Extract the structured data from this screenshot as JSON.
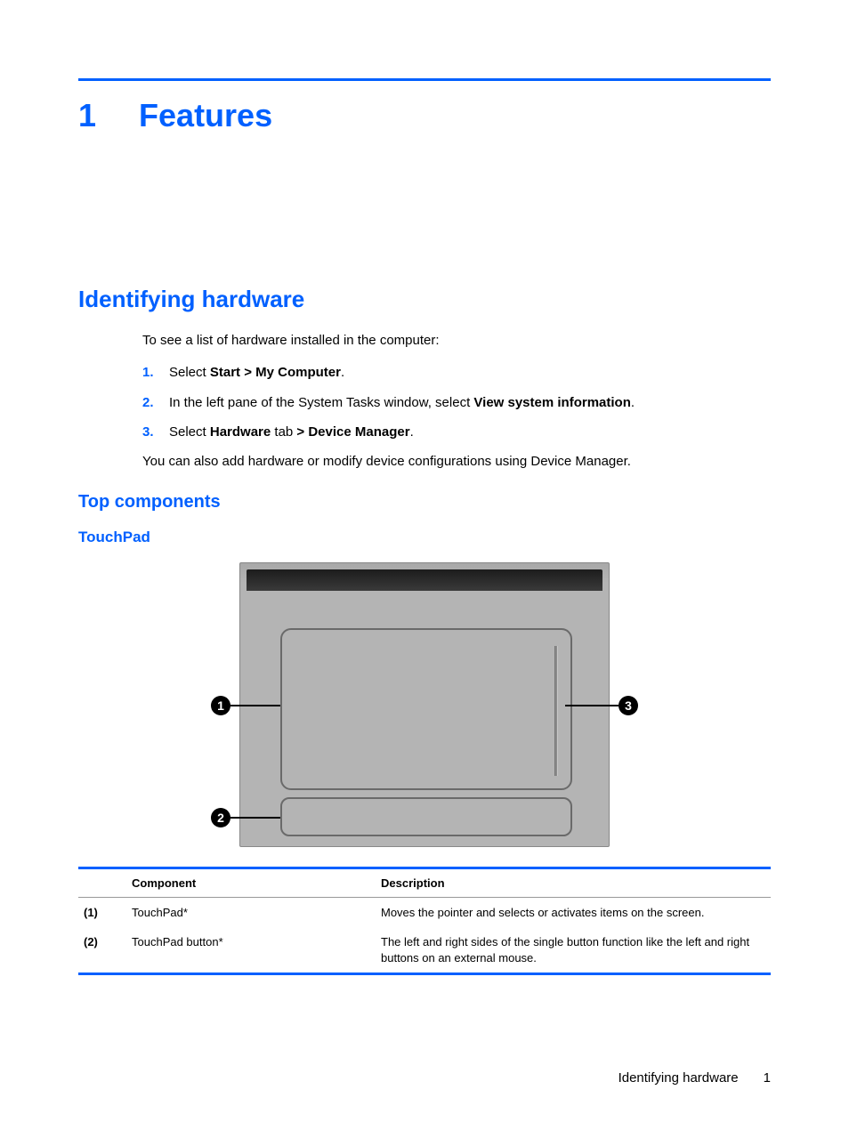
{
  "chapter": {
    "number": "1",
    "title": "Features"
  },
  "section": {
    "title": "Identifying hardware"
  },
  "intro": "To see a list of hardware installed in the computer:",
  "steps": [
    {
      "num": "1.",
      "pre": "Select ",
      "bold": "Start > My Computer",
      "post": "."
    },
    {
      "num": "2.",
      "pre": "In the left pane of the System Tasks window, select ",
      "bold": "View system information",
      "post": "."
    },
    {
      "num": "3.",
      "pre": "Select ",
      "bold": "Hardware",
      "mid": " tab ",
      "bold2": "> Device Manager",
      "post": "."
    }
  ],
  "outro": "You can also add hardware or modify device configurations using Device Manager.",
  "subsection": {
    "title": "Top components"
  },
  "subsubsection": {
    "title": "TouchPad"
  },
  "callouts": {
    "c1": "1",
    "c2": "2",
    "c3": "3"
  },
  "table": {
    "headers": {
      "component": "Component",
      "description": "Description"
    },
    "rows": [
      {
        "idx": "(1)",
        "component": "TouchPad*",
        "description": "Moves the pointer and selects or activates items on the screen."
      },
      {
        "idx": "(2)",
        "component": "TouchPad button*",
        "description": "The left and right sides of the single button function like the left and right buttons on an external mouse."
      }
    ]
  },
  "footer": {
    "section": "Identifying hardware",
    "page": "1"
  }
}
